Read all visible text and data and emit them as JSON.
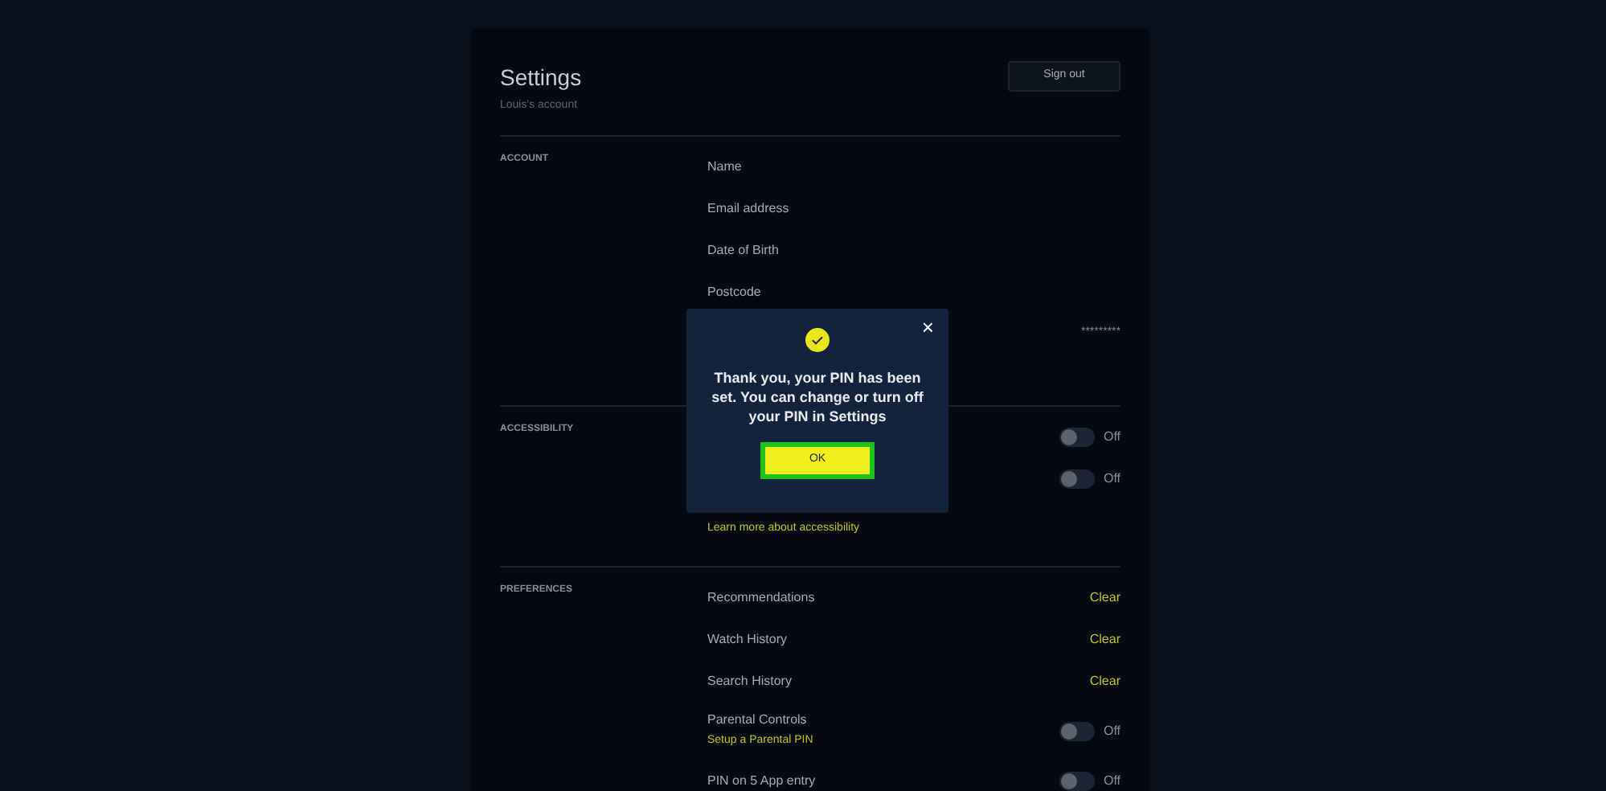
{
  "header": {
    "title": "Settings",
    "subtitle": "Louis's account",
    "sign_out": "Sign out"
  },
  "sections": [
    {
      "title": "ACCOUNT",
      "rows": [
        {
          "kind": "text",
          "label": "Name"
        },
        {
          "kind": "text",
          "label": "Email address"
        },
        {
          "kind": "text",
          "label": "Date of Birth"
        },
        {
          "kind": "text",
          "label": "Postcode"
        },
        {
          "kind": "value",
          "value": "*********"
        }
      ]
    },
    {
      "title": "ACCESSIBILITY",
      "rows": [
        {
          "kind": "toggle",
          "on": false,
          "state": "Off"
        },
        {
          "kind": "toggle",
          "on": false,
          "state": "Off"
        },
        {
          "kind": "link",
          "link": "Learn more about accessibility"
        }
      ]
    },
    {
      "title": "PREFERENCES",
      "rows": [
        {
          "kind": "action",
          "label": "Recommendations",
          "action": "Clear"
        },
        {
          "kind": "action",
          "label": "Watch History",
          "action": "Clear"
        },
        {
          "kind": "action",
          "label": "Search History",
          "action": "Clear"
        },
        {
          "kind": "toggle",
          "label": "Parental Controls",
          "link": "Setup a Parental PIN",
          "on": false,
          "state": "Off"
        },
        {
          "kind": "toggle",
          "label": "PIN on 5 App entry",
          "on": false,
          "state": "Off"
        }
      ]
    }
  ],
  "dialog": {
    "message": "Thank you, your PIN has been set. You can change or turn off your PIN in Settings",
    "button": "OK",
    "close": "×"
  }
}
